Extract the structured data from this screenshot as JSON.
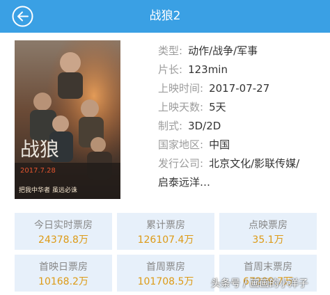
{
  "header": {
    "title": "战狼2",
    "back_icon": "back-arrow-icon"
  },
  "poster": {
    "tag": "把我中华者 虽远必诛"
  },
  "info": [
    {
      "label": "类型:",
      "value": "动作/战争/军事"
    },
    {
      "label": "片长:",
      "value": "123min"
    },
    {
      "label": "上映时间:",
      "value": "2017-07-27"
    },
    {
      "label": "上映天数:",
      "value": "5天"
    },
    {
      "label": "制式:",
      "value": "3D/2D"
    },
    {
      "label": "国家地区:",
      "value": "中国"
    },
    {
      "label": "发行公司:",
      "value": "北京文化/影联传媒/"
    }
  ],
  "info_continuation": "启泰远洋…",
  "stats": [
    {
      "label": "今日实时票房",
      "value": "24378.8万"
    },
    {
      "label": "累计票房",
      "value": "126107.4万"
    },
    {
      "label": "点映票房",
      "value": "35.1万"
    },
    {
      "label": "首映日票房",
      "value": "10168.2万"
    },
    {
      "label": "首周票房",
      "value": "101708.5万"
    },
    {
      "label": "首周末票房",
      "value": "67209.7万"
    }
  ],
  "watermark": "头条号 / 画画的小洋子",
  "colors": {
    "header": "#3aa0e4",
    "stat_value": "#dd9a16",
    "cell_bg": "#e7f0fa"
  }
}
